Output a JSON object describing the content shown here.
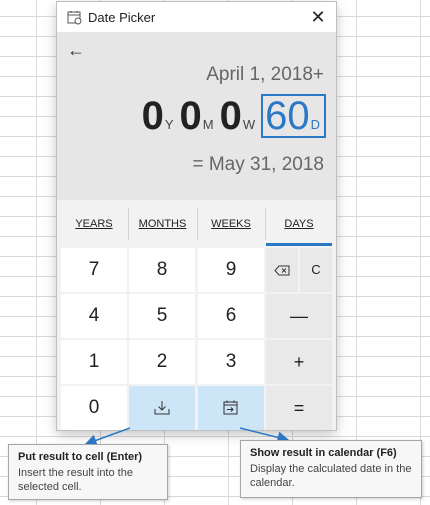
{
  "window": {
    "title": "Date Picker",
    "app_icon": "calendar-icon",
    "close_icon": "close-icon",
    "close_symbol": "✕"
  },
  "display": {
    "back_icon": "back-arrow-icon",
    "back_symbol": "←",
    "start_date": "April 1, 2018+",
    "duration": {
      "years": "0",
      "years_unit": "Y",
      "months": "0",
      "months_unit": "M",
      "weeks": "0",
      "weeks_unit": "W",
      "days": "60",
      "days_unit": "D"
    },
    "result_date": "= May 31, 2018"
  },
  "tabs": [
    {
      "label": "YEARS",
      "active": false
    },
    {
      "label": "MONTHS",
      "active": false
    },
    {
      "label": "WEEKS",
      "active": false
    },
    {
      "label": "DAYS",
      "active": true
    }
  ],
  "keypad": {
    "row1": [
      "7",
      "8",
      "9"
    ],
    "row2": [
      "4",
      "5",
      "6"
    ],
    "row3": [
      "1",
      "2",
      "3"
    ],
    "zero": "0",
    "backspace_icon": "backspace-icon",
    "clear": "C",
    "minus": "—",
    "plus": "+",
    "equals": "=",
    "put_result_icon": "download-to-cell-icon",
    "show_calendar_icon": "calendar-arrow-icon"
  },
  "tooltips": {
    "put_result": {
      "title": "Put result to cell (Enter)",
      "desc": "Insert the result into the selected cell."
    },
    "show_calendar": {
      "title": "Show result in calendar (F6)",
      "desc": "Display the calculated date in the calendar."
    }
  },
  "colors": {
    "accent": "#2b78c6",
    "highlight_key": "#cde6f7",
    "display_bg": "#e6e6e6"
  }
}
